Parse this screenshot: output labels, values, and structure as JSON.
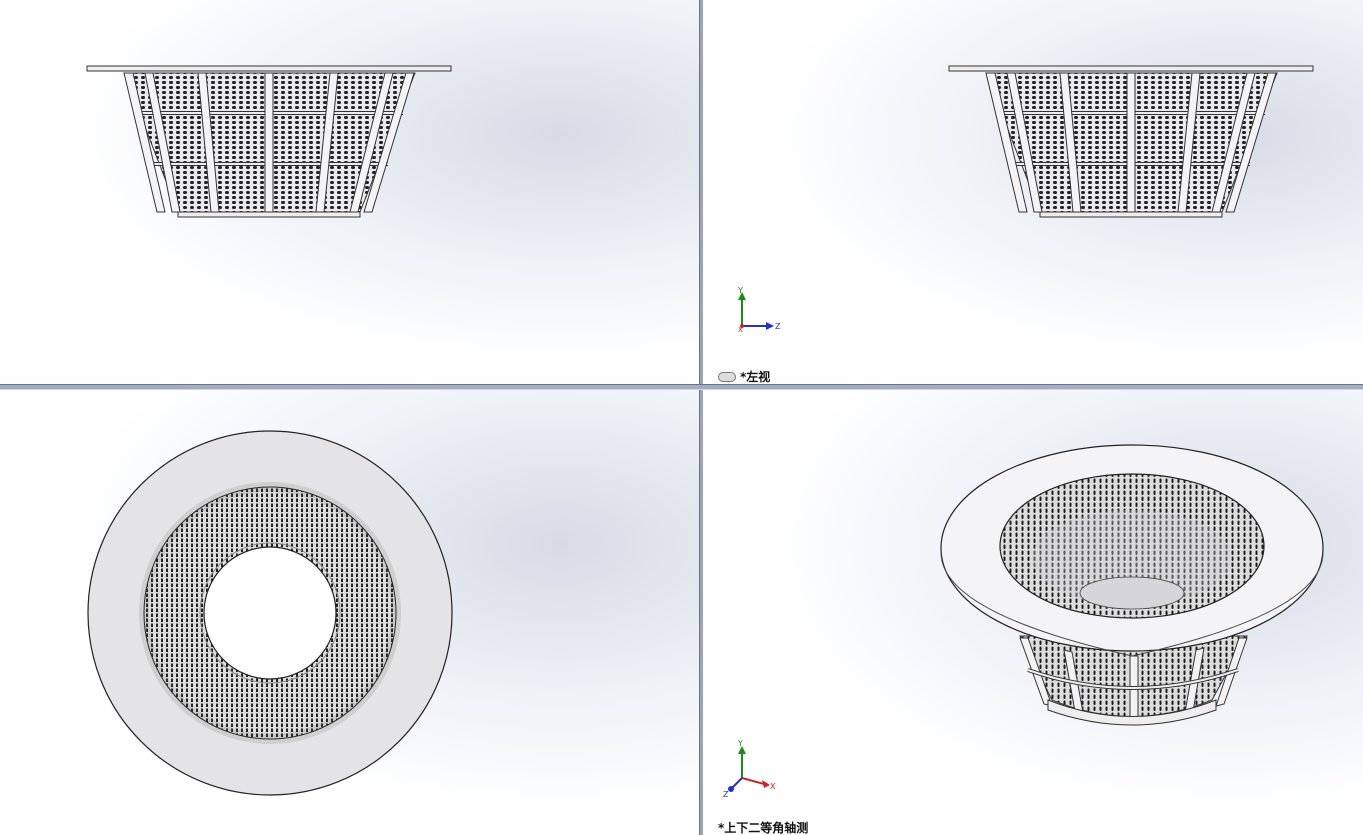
{
  "viewports": {
    "top_left": {
      "label": ""
    },
    "top_right": {
      "label": "*左视",
      "link_icon": "link-icon"
    },
    "bottom_left": {
      "label": ""
    },
    "bottom_right": {
      "label": "*上下二等角轴测"
    }
  },
  "triad_labels": {
    "y": "Y",
    "x": "X",
    "z": "Z"
  },
  "colors": {
    "axis_x": "#cc2222",
    "axis_y": "#1a8a1a",
    "axis_z": "#2233cc",
    "divider": "#9aa6b8"
  }
}
